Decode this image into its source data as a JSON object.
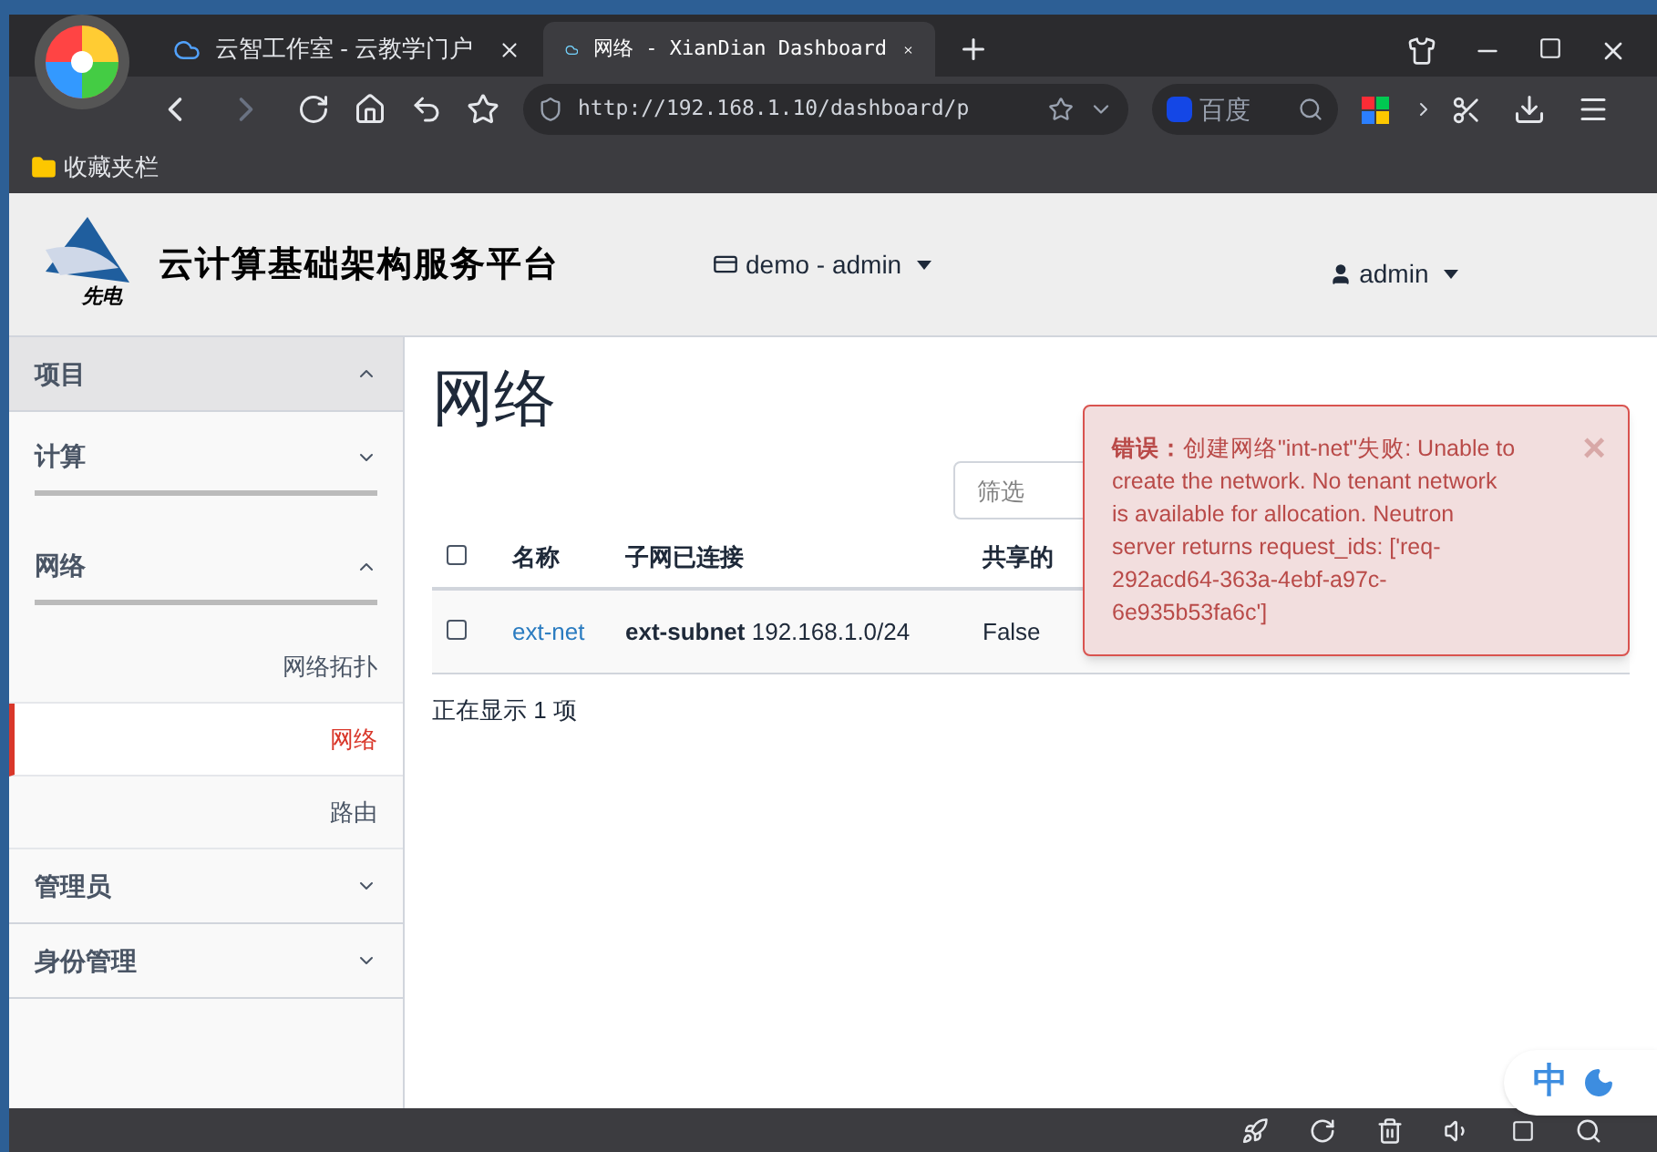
{
  "browser": {
    "tabs": [
      {
        "label": "云智工作室  - 云教学门户",
        "selected": false
      },
      {
        "label": "网络 - XianDian Dashboard",
        "selected": true
      }
    ],
    "url": "http://192.168.1.10/dashboard/p",
    "search_placeholder": "百度",
    "bookmarks": [
      "收藏夹栏"
    ]
  },
  "header": {
    "title": "云计算基础架构服务平台",
    "logo_text": "先电",
    "project": "demo - admin",
    "user": "admin"
  },
  "sidebar": {
    "items": [
      {
        "kind": "section",
        "label": "项目",
        "expanded": true
      },
      {
        "kind": "group",
        "label": "计算",
        "expanded": false
      },
      {
        "kind": "group",
        "label": "网络",
        "expanded": true
      },
      {
        "kind": "link",
        "label": "网络拓扑",
        "selected": false
      },
      {
        "kind": "link",
        "label": "网络",
        "selected": true
      },
      {
        "kind": "link",
        "label": "路由",
        "selected": false
      },
      {
        "kind": "section",
        "label": "管理员",
        "expanded": false
      },
      {
        "kind": "section",
        "label": "身份管理",
        "expanded": false
      }
    ]
  },
  "page": {
    "title": "网络",
    "filter_placeholder": "筛选",
    "table": {
      "select_all_checked": false,
      "columns": [
        "名称",
        "子网已连接",
        "共享的"
      ],
      "rows": [
        {
          "name": "ext-net",
          "subnet_name": "ext-subnet",
          "subnet_cidr": "192.168.1.0/24",
          "shared": "False",
          "checked": false
        }
      ]
    },
    "footer": "正在显示 1 项"
  },
  "alert": {
    "message": "**错误：**创建网络\"int-net\"失败: Unable to create the network. No tenant network is available for allocation. Neutron server returns request_ids: ['req-292acd64-363a-4ebf-a97c-6e935b53fa6c']",
    "close": "×"
  },
  "ime": {
    "label": "中"
  }
}
